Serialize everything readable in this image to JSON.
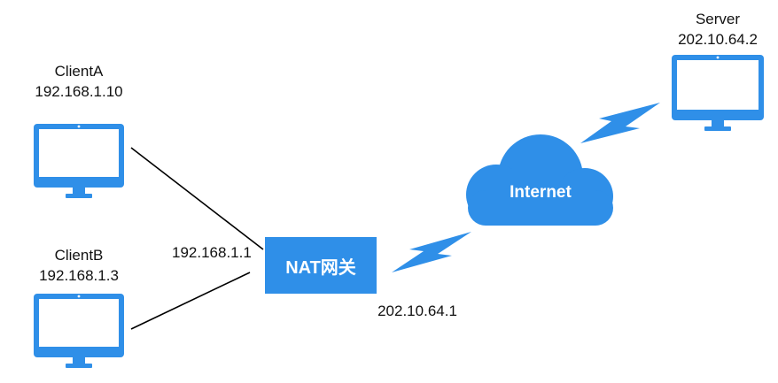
{
  "clients": [
    {
      "name": "ClientA",
      "ip": "192.168.1.10"
    },
    {
      "name": "ClientB",
      "ip": "192.168.1.3"
    }
  ],
  "gateway": {
    "label": "NAT网关",
    "lan_ip": "192.168.1.1",
    "wan_ip": "202.10.64.1"
  },
  "internet": {
    "label": "Internet"
  },
  "server": {
    "name": "Server",
    "ip": "202.10.64.2"
  },
  "colors": {
    "accent": "#2f8fe8",
    "line": "#000000",
    "text": "#111111"
  },
  "icons": [
    "monitor-icon",
    "cloud-icon",
    "lightning-icon"
  ]
}
